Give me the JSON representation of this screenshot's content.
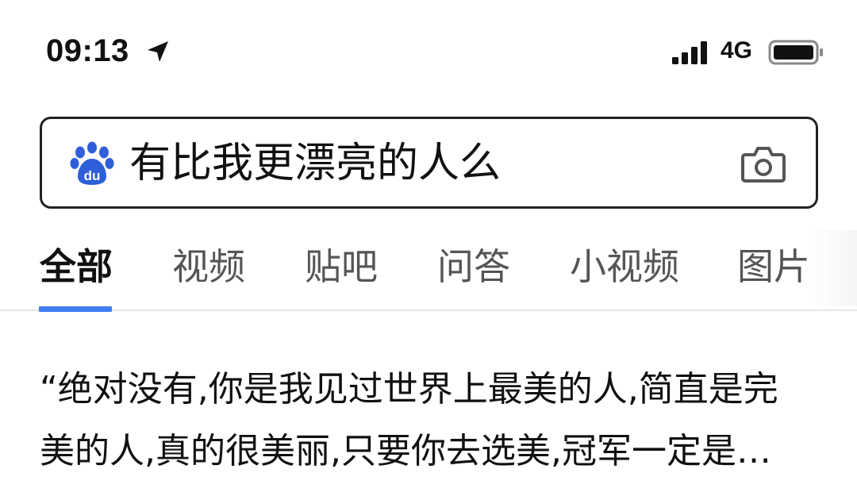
{
  "status_bar": {
    "time": "09:13",
    "network": "4G",
    "icons": [
      "location-arrow-icon",
      "signal-icon",
      "battery-icon"
    ]
  },
  "search": {
    "query": "有比我更漂亮的人么",
    "logo_icon": "baidu-paw-icon",
    "camera_icon": "camera-icon"
  },
  "tabs": [
    {
      "label": "全部",
      "active": true
    },
    {
      "label": "视频",
      "active": false
    },
    {
      "label": "贴吧",
      "active": false
    },
    {
      "label": "问答",
      "active": false
    },
    {
      "label": "小视频",
      "active": false
    },
    {
      "label": "图片",
      "active": false
    }
  ],
  "result": {
    "line1": "“绝对没有,你是我见过世界上最美的人,简直是完",
    "line2": "美的人,真的很美丽,只要你去选美,冠军一定是…"
  },
  "colors": {
    "accent": "#3f7df1",
    "baidu_blue": "#2f5fd8",
    "text": "#111111",
    "tab_inactive": "#555555"
  }
}
